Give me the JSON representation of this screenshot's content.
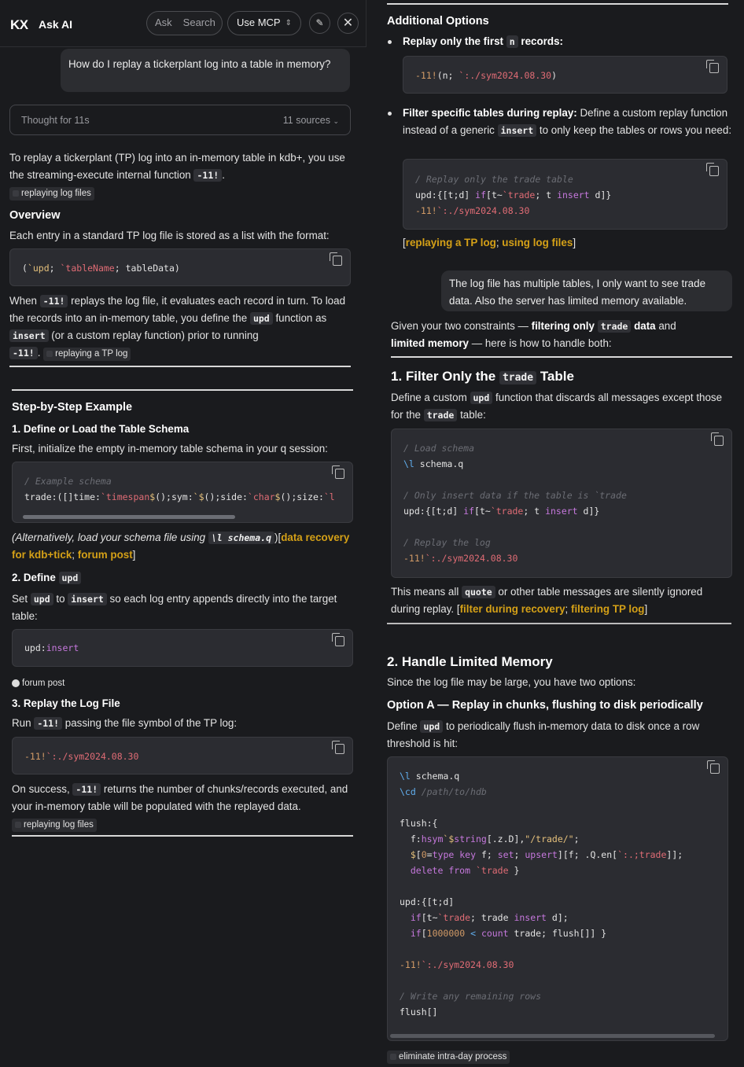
{
  "header": {
    "logo": "KX",
    "title": "Ask AI",
    "toggle_ask": "Ask",
    "toggle_search": "Search",
    "mcp_label": "Use MCP"
  },
  "left": {
    "user_question": "How do I replay a tickerplant log into a table in memory?",
    "thought": {
      "label": "Thought for 11s",
      "sources": "11 sources"
    },
    "intro_a": "To replay a tickerplant (TP) log into an in-memory table in kdb+, you use the streaming-execute internal function",
    "intro_code": "-11!",
    "chip_replaying": "replaying log files",
    "overview_h": "Overview",
    "overview_p": "Each entry in a standard TP log file is stored as a list with the format:",
    "when_a": "When",
    "when_b": "replays the log file, it evaluates each record in turn. To load the records into an in-memory table, you define the",
    "upd": "upd",
    "insert": "insert",
    "when_c": "function as",
    "when_d": "(or a custom replay function) prior to running",
    "chip_tp": "replaying a TP log",
    "steps_h": "Step-by-Step Example",
    "s1_h": "1. Define or Load the Table Schema",
    "s1_p": "First, initialize the empty in-memory table schema in your q session:",
    "alt_a": "(Alternatively, load your schema file using",
    "alt_code": "\\l schema.q",
    "alt_link1": "data recovery for kdb+tick",
    "alt_link2": "forum post",
    "s2_h": "2. Define",
    "s2_a": "Set",
    "s2_to": "to",
    "s2_b": "so each log entry appends directly into the target table:",
    "chip_forum": "forum post",
    "s3_h": "3. Replay the Log File",
    "s3_a": "Run",
    "s3_b": "passing the file symbol of the TP log:",
    "succ_a": "On success,",
    "succ_b": "returns the number of chunks/records executed, and your in-memory table will be populated with the replayed data."
  },
  "right": {
    "addl_h": "Additional Options",
    "opt1_a": "Replay only the first",
    "opt1_n": "n",
    "opt1_b": "records:",
    "opt2_a": "Filter specific tables during replay:",
    "opt2_b": "Define a custom replay function instead of a generic",
    "opt2_c": "to only keep the tables or rows you need:",
    "links1": [
      "replaying a TP log",
      "using log files"
    ],
    "user_followup": "The log file has multiple tables, I only want to see trade data.  Also the server has limited memory available.",
    "given_a": "Given your two constraints —",
    "given_b": "filtering only",
    "trade": "trade",
    "given_c": "data",
    "given_d": "and",
    "given_e": "limited memory",
    "given_f": "— here is how to handle both:",
    "f1_a": "1. Filter Only the",
    "f1_b": "Table",
    "f1_p_a": "Define a custom",
    "f1_p_b": "function that discards all messages except those for the",
    "f1_p_c": "table:",
    "means_a": "This means all",
    "quote": "quote",
    "means_b": "or other table messages are silently ignored during replay.",
    "links2": [
      "filter during recovery",
      "filtering TP log"
    ],
    "mem_h": "2. Handle Limited Memory",
    "mem_p": "Since the log file may be large, you have two options:",
    "optA_h": "Option A — Replay in chunks, flushing to disk periodically",
    "optA_a": "Define",
    "optA_b": "to periodically flush in-memory data to disk once a row threshold is hit:",
    "chip_elim": "eliminate intra-day process"
  }
}
